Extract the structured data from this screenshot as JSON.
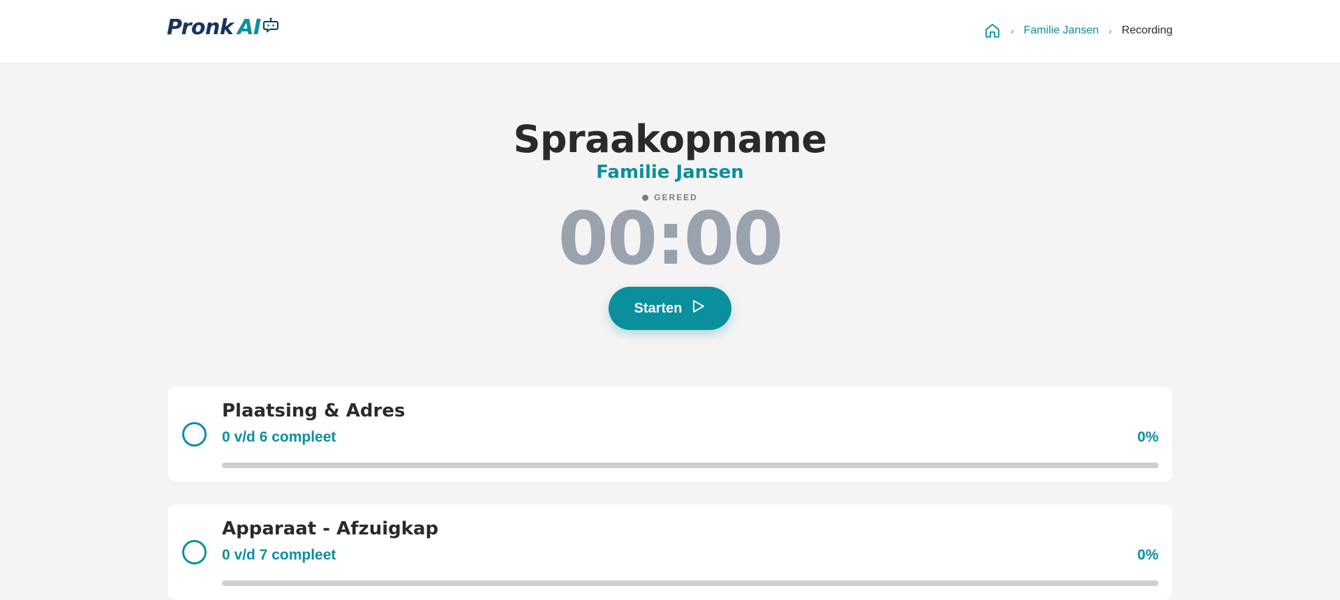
{
  "header": {
    "logo": {
      "text_main": "Pronk",
      "text_accent": "AI",
      "icon": "robot-chat-icon"
    },
    "breadcrumb": {
      "home_icon": "home-icon",
      "separator": "›",
      "items": [
        {
          "label": "Familie Jansen"
        },
        {
          "label": "Recording"
        }
      ]
    }
  },
  "main": {
    "title": "Spraakopname",
    "subtitle": "Familie Jansen",
    "status": "GEREED",
    "timer": "00:00",
    "start_button": {
      "label": "Starten",
      "icon": "play-icon"
    }
  },
  "sections": [
    {
      "title": "Plaatsing & Adres",
      "progress_text": "0 v/d 6 compleet",
      "percent_label": "0%",
      "progress": 0
    },
    {
      "title": "Apparaat - Afzuigkap",
      "progress_text": "0 v/d 7 compleet",
      "percent_label": "0%",
      "progress": 0
    }
  ],
  "colors": {
    "accent": "#0a8f9d",
    "brand_dark": "#16345c",
    "timer_idle": "#9aa2ae",
    "background": "#f4f4f4"
  }
}
